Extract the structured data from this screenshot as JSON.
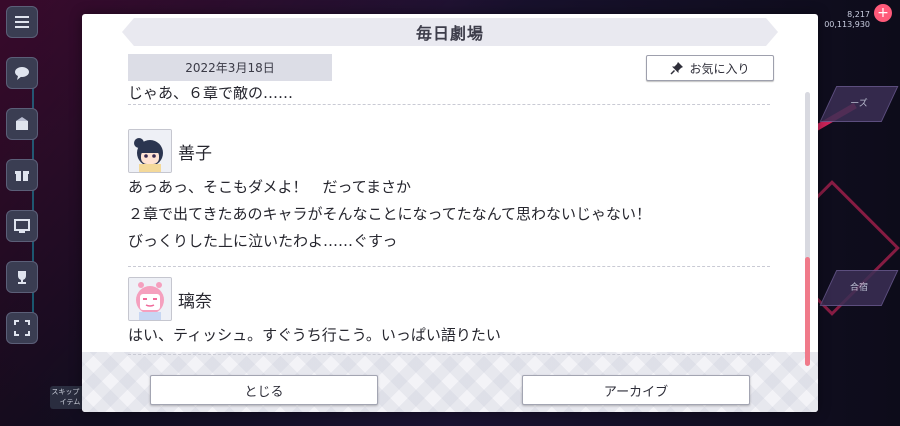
{
  "background": {
    "stats": [
      "8,217",
      "00,113,930"
    ],
    "right_tiles": [
      "ーズ",
      "合宿"
    ],
    "bottom_tag": "スキップ\nアイテム"
  },
  "dialog": {
    "title": "毎日劇場",
    "date": "2022年3月18日",
    "favorite_label": "お気に入り",
    "close_label": "とじる",
    "archive_label": "アーカイブ"
  },
  "conversation": {
    "cut_line": "じゃあ、６章で敵の……",
    "messages": [
      {
        "speaker": "善子",
        "lines": [
          "あっあっ、そこもダメよ！　だってまさか",
          "２章で出てきたあのキャラがそんなことになってたなんて思わないじゃない！",
          "びっくりした上に泣いたわよ……ぐすっ"
        ]
      },
      {
        "speaker": "璃奈",
        "lines": [
          "はい、ティッシュ。すぐうち行こう。いっぱい語りたい"
        ]
      }
    ]
  },
  "colors": {
    "accent_scroll": "#f07a8a",
    "title_bar": "#e9e9f0",
    "date_bg": "#dcdde6"
  }
}
